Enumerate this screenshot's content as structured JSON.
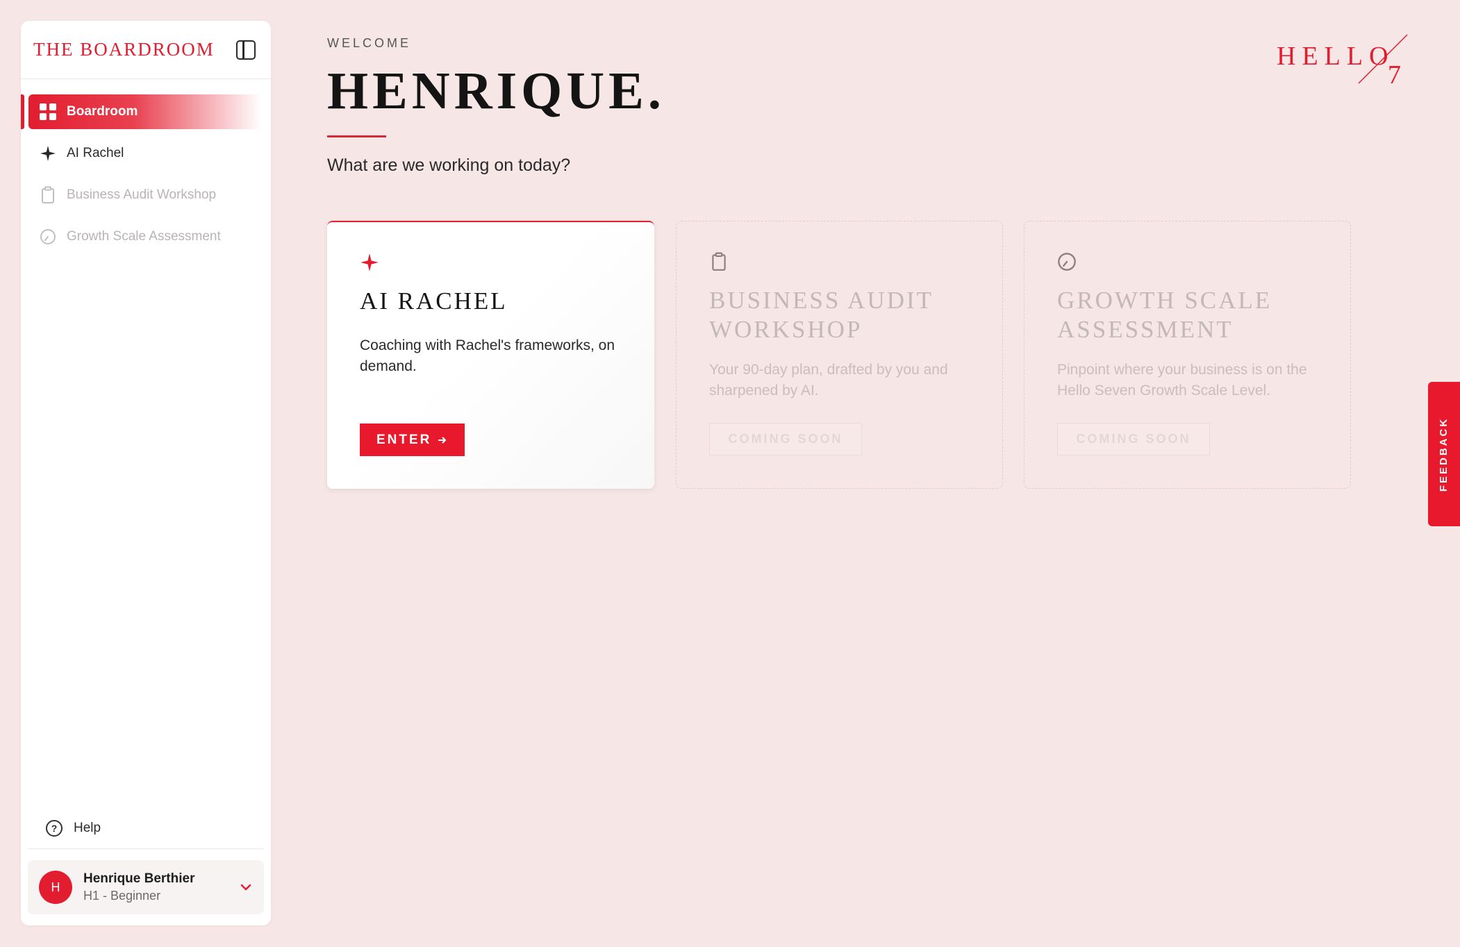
{
  "sidebar": {
    "brand": "THE BOARDROOM",
    "collapse_icon": "sidebar-panel-icon",
    "items": [
      {
        "label": "Boardroom",
        "icon": "grid-icon",
        "state": "active"
      },
      {
        "label": "AI Rachel",
        "icon": "sparkle-icon",
        "state": "enabled"
      },
      {
        "label": "Business Audit Workshop",
        "icon": "clipboard-icon",
        "state": "disabled"
      },
      {
        "label": "Growth Scale Assessment",
        "icon": "gauge-icon",
        "state": "disabled"
      }
    ],
    "help_label": "Help",
    "user": {
      "initial": "H",
      "name": "Henrique Berthier",
      "level": "H1 - Beginner"
    }
  },
  "header": {
    "welcome": "WELCOME",
    "name": "HENRIQUE.",
    "subtitle": "What are we working on today?",
    "logo_text": "HELLO",
    "logo_number": "7"
  },
  "cards": [
    {
      "title": "AI RACHEL",
      "description": "Coaching with Rachel's frameworks, on demand.",
      "button": "ENTER",
      "icon": "sparkle-icon",
      "status": "available"
    },
    {
      "title": "BUSINESS AUDIT WORKSHOP",
      "description": "Your 90-day plan, drafted by you and sharpened by AI.",
      "button": "COMING SOON",
      "icon": "clipboard-icon",
      "status": "coming-soon"
    },
    {
      "title": "GROWTH SCALE ASSESSMENT",
      "description": "Pinpoint where your business is on the Hello Seven Growth Scale Level.",
      "button": "COMING SOON",
      "icon": "gauge-icon",
      "status": "coming-soon"
    }
  ],
  "feedback_label": "FEEDBACK",
  "colors": {
    "accent": "#e21d30",
    "background": "#f7e6e6",
    "surface": "#ffffff",
    "muted_text": "#c3b8b8"
  }
}
